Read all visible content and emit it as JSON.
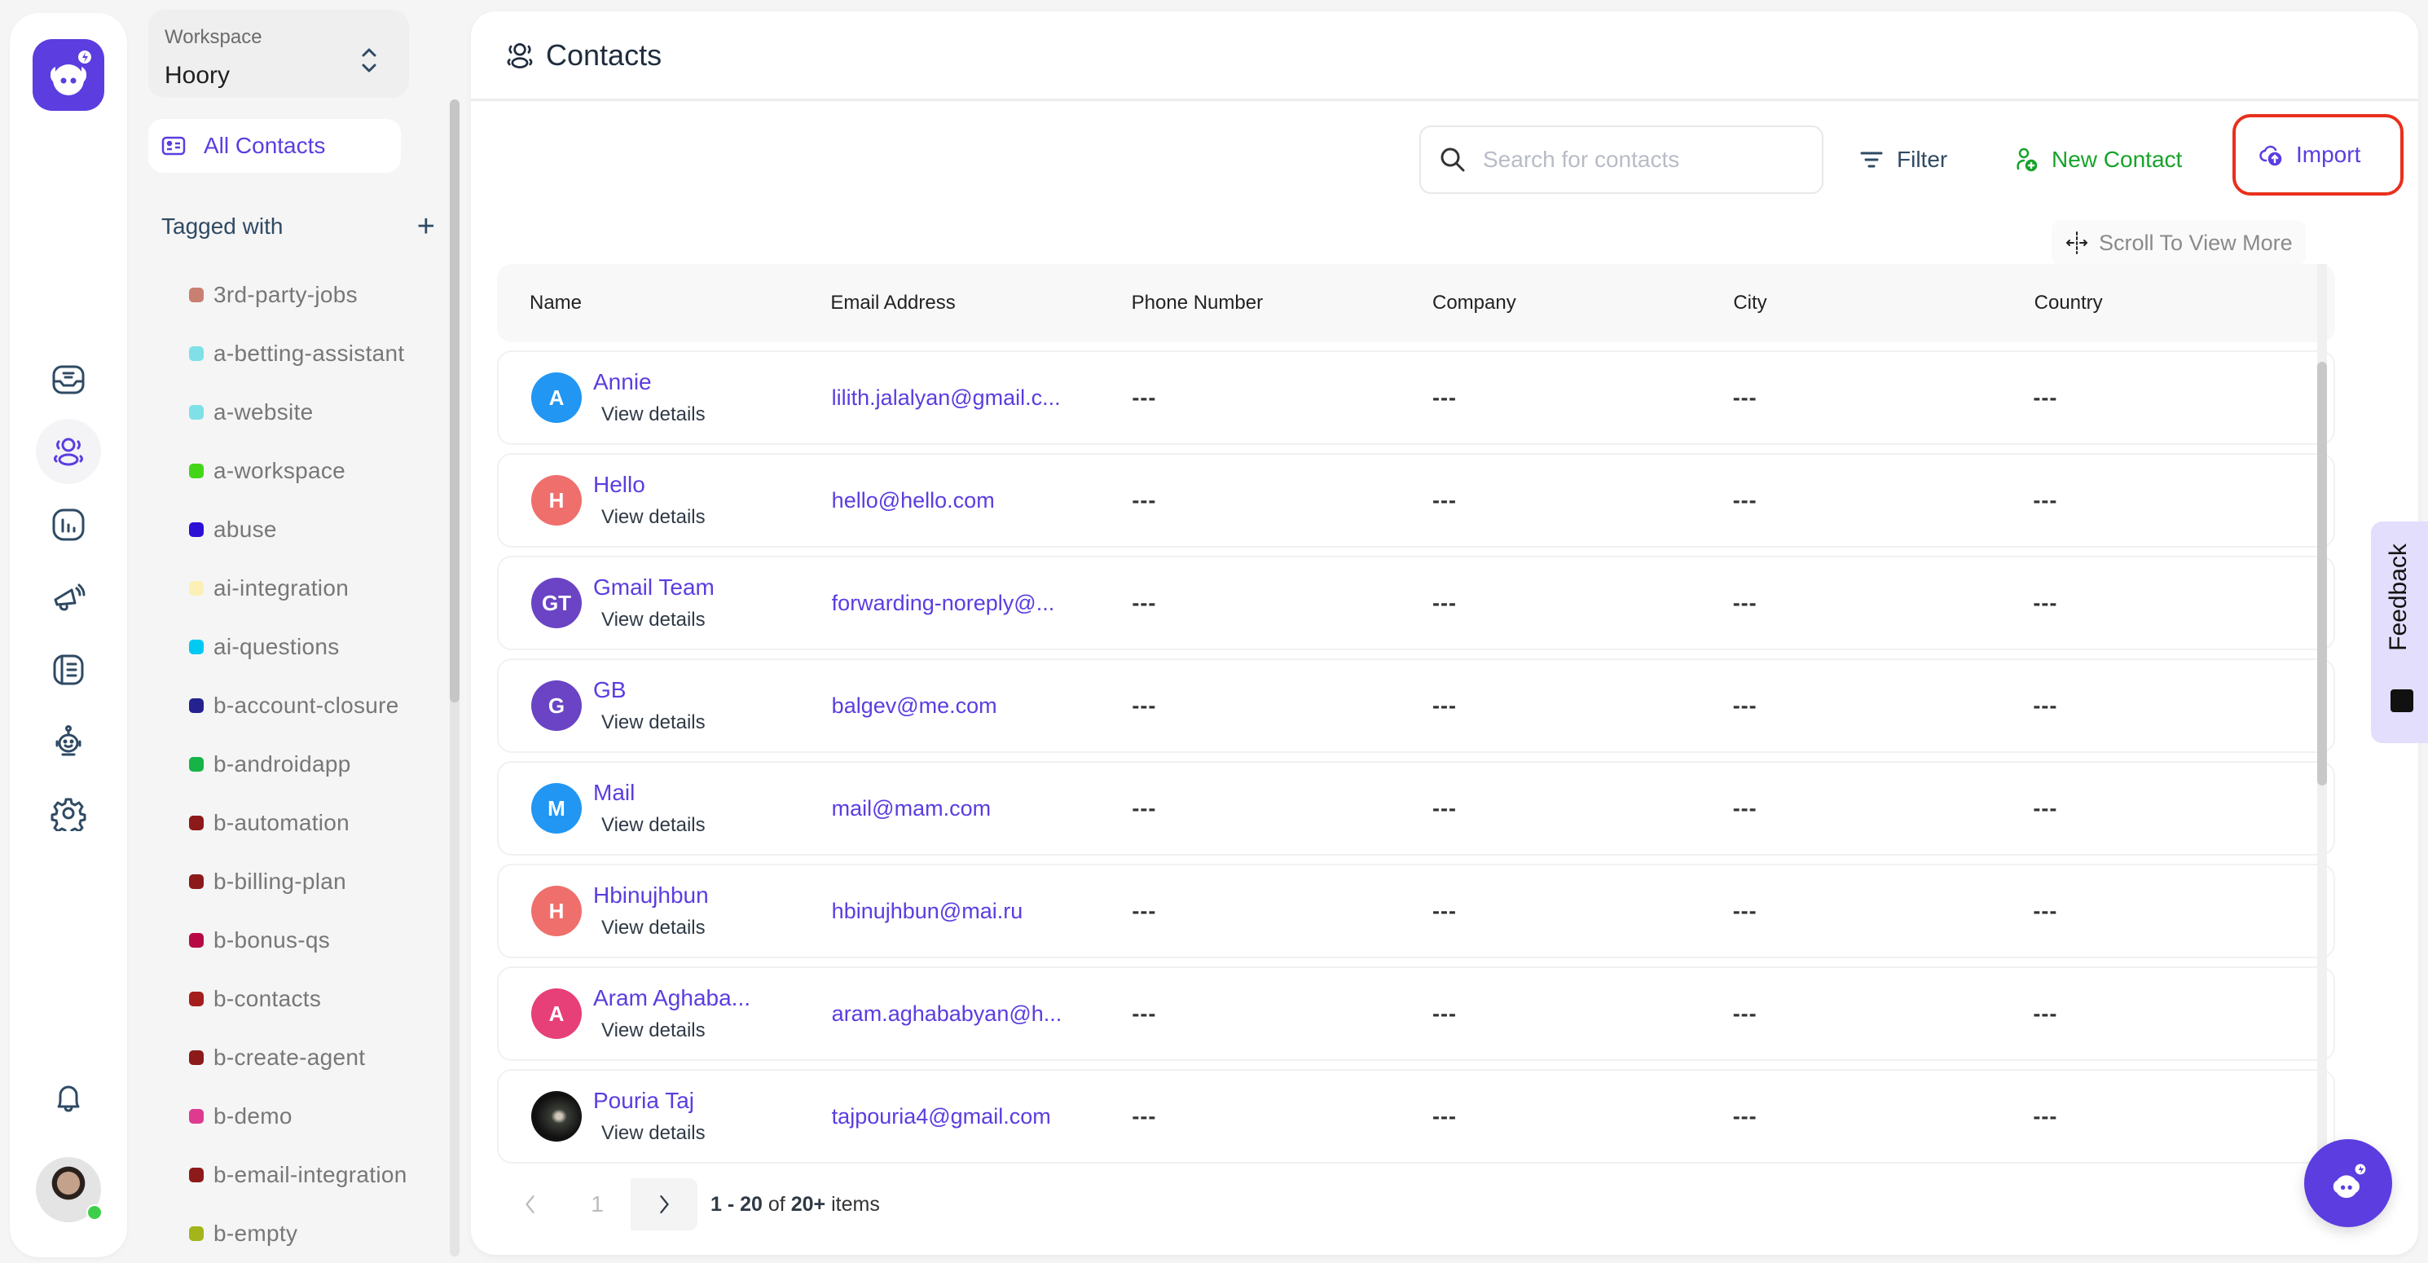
{
  "app": {
    "brand_color": "#5b3de0"
  },
  "rail": {
    "items": [
      {
        "icon": "inbox-icon"
      },
      {
        "icon": "contacts-icon",
        "active": true
      },
      {
        "icon": "reports-icon"
      },
      {
        "icon": "campaigns-icon"
      },
      {
        "icon": "knowledge-base-icon"
      },
      {
        "icon": "bot-icon"
      },
      {
        "icon": "settings-icon"
      }
    ],
    "bottom": [
      {
        "icon": "bell-icon"
      },
      {
        "icon": "user-avatar",
        "status": "online"
      }
    ]
  },
  "sidebar": {
    "workspace_label": "Workspace",
    "workspace_value": "Hoory",
    "all_contacts": "All Contacts",
    "tagged_with": "Tagged with",
    "tags": [
      {
        "name": "3rd-party-jobs",
        "color": "#c97f72"
      },
      {
        "name": "a-betting-assistant",
        "color": "#7fe0e8"
      },
      {
        "name": "a-website",
        "color": "#7fe0e8"
      },
      {
        "name": "a-workspace",
        "color": "#44d616"
      },
      {
        "name": "abuse",
        "color": "#2d10d6"
      },
      {
        "name": "ai-integration",
        "color": "#fbf1b8"
      },
      {
        "name": "ai-questions",
        "color": "#00caf4"
      },
      {
        "name": "b-account-closure",
        "color": "#25228f"
      },
      {
        "name": "b-androidapp",
        "color": "#16b446"
      },
      {
        "name": "b-automation",
        "color": "#8c1a1a"
      },
      {
        "name": "b-billing-plan",
        "color": "#8c1a1a"
      },
      {
        "name": "b-bonus-qs",
        "color": "#b70a44"
      },
      {
        "name": "b-contacts",
        "color": "#a51e1e"
      },
      {
        "name": "b-create-agent",
        "color": "#8c1a1a"
      },
      {
        "name": "b-demo",
        "color": "#dd3a90"
      },
      {
        "name": "b-email-integration",
        "color": "#8c1a1a"
      },
      {
        "name": "b-empty",
        "color": "#a3b51a"
      }
    ]
  },
  "header": {
    "title": "Contacts"
  },
  "toolbar": {
    "search_placeholder": "Search for contacts",
    "search_value": "",
    "filter_label": "Filter",
    "new_contact_label": "New Contact",
    "import_label": "Import",
    "scroll_hint": "Scroll To View More"
  },
  "table": {
    "columns": [
      "Name",
      "Email Address",
      "Phone Number",
      "Company",
      "City",
      "Country"
    ],
    "view_details_label": "View details",
    "rows": [
      {
        "initials": "A",
        "avatar_color": "#2196f3",
        "name": "Annie",
        "email": "lilith.jalalyan@gmail.c...",
        "phone": "---",
        "company": "---",
        "city": "---",
        "country": "---"
      },
      {
        "initials": "H",
        "avatar_color": "#ef6f6c",
        "name": "Hello",
        "email": "hello@hello.com",
        "phone": "---",
        "company": "---",
        "city": "---",
        "country": "---"
      },
      {
        "initials": "GT",
        "avatar_color": "#6a44c4",
        "name": "Gmail Team",
        "email": "forwarding-noreply@...",
        "phone": "---",
        "company": "---",
        "city": "---",
        "country": "---"
      },
      {
        "initials": "G",
        "avatar_color": "#6a44c4",
        "name": "GB",
        "email": "balgev@me.com",
        "phone": "---",
        "company": "---",
        "city": "---",
        "country": "---"
      },
      {
        "initials": "M",
        "avatar_color": "#2196f3",
        "name": "Mail",
        "email": "mail@mam.com",
        "phone": "---",
        "company": "---",
        "city": "---",
        "country": "---"
      },
      {
        "initials": "H",
        "avatar_color": "#ef6f6c",
        "name": "Hbinujhbun",
        "email": "hbinujhbun@mai.ru",
        "phone": "---",
        "company": "---",
        "city": "---",
        "country": "---"
      },
      {
        "initials": "A",
        "avatar_color": "#e73f78",
        "name": "Aram Aghaba...",
        "email": "aram.aghababyan@h...",
        "phone": "---",
        "company": "---",
        "city": "---",
        "country": "---"
      },
      {
        "initials": "",
        "avatar_color": "photo",
        "name": "Pouria Taj",
        "email": "tajpouria4@gmail.com",
        "phone": "---",
        "company": "---",
        "city": "---",
        "country": "---"
      }
    ]
  },
  "pagination": {
    "current_page": "1",
    "range_start": "1",
    "range_end": "20",
    "total": "20+",
    "of_label": "of",
    "items_label": "items"
  },
  "feedback": {
    "label": "Feedback"
  }
}
